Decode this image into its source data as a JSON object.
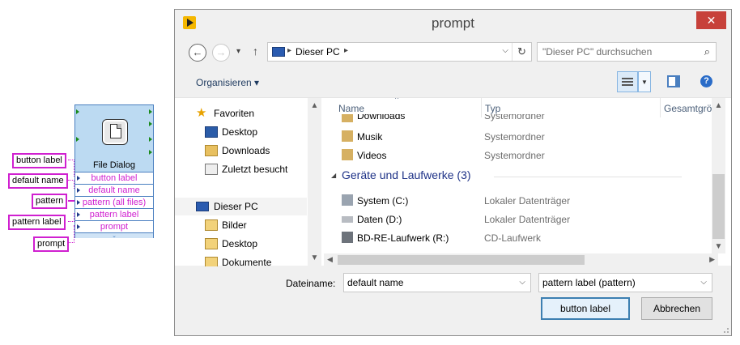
{
  "diagram": {
    "labels": {
      "button_label": "button label",
      "default_name": "default name",
      "pattern": "pattern",
      "pattern_label": "pattern label",
      "prompt": "prompt"
    },
    "node": {
      "title": "File Dialog",
      "terminals": [
        "button label",
        "default name",
        "pattern (all files)",
        "pattern label",
        "prompt"
      ]
    }
  },
  "dialog": {
    "title": "prompt",
    "close_glyph": "✕",
    "nav": {
      "back": "←",
      "forward": "→",
      "history": "▾",
      "up": "↑",
      "path": "Dieser PC",
      "path_sep": "▸",
      "dropdown": "⌵",
      "refresh": "↻",
      "search_placeholder": "\"Dieser PC\" durchsuchen",
      "search_glyph": "⌕"
    },
    "toolbar": {
      "organize": "Organisieren ▾",
      "view_dropdown": "▼",
      "help": "?"
    },
    "nav_pane": {
      "items": [
        {
          "label": "Favoriten",
          "icon": "star-icon"
        },
        {
          "label": "Desktop",
          "icon": "desktop-icon"
        },
        {
          "label": "Downloads",
          "icon": "downloads-icon"
        },
        {
          "label": "Zuletzt besucht",
          "icon": "recent-icon"
        },
        {
          "label": "Dieser PC",
          "icon": "computer-icon"
        },
        {
          "label": "Bilder",
          "icon": "pictures-icon"
        },
        {
          "label": "Desktop",
          "icon": "desktop-icon"
        },
        {
          "label": "Dokumente",
          "icon": "documents-icon"
        }
      ]
    },
    "columns": [
      "Name",
      "Typ",
      "Gesamtgröße"
    ],
    "rows": [
      {
        "name": "Downloads",
        "type": "Systemordner",
        "icon": "downloads-folder-icon"
      },
      {
        "name": "Musik",
        "type": "Systemordner",
        "icon": "music-folder-icon"
      },
      {
        "name": "Videos",
        "type": "Systemordner",
        "icon": "videos-folder-icon"
      }
    ],
    "group": {
      "title": "Geräte und Laufwerke (3)",
      "toggle": "◢"
    },
    "devices": [
      {
        "name": "System (C:)",
        "type": "Lokaler Datenträger",
        "icon": "system-drive-icon"
      },
      {
        "name": "Daten (D:)",
        "type": "Lokaler Datenträger",
        "icon": "hard-drive-icon"
      },
      {
        "name": "BD-RE-Laufwerk (R:)",
        "type": "CD-Laufwerk",
        "icon": "optical-drive-icon"
      }
    ],
    "filename_label": "Dateiname:",
    "filename_value": "default name",
    "filter_value": "pattern label (pattern)",
    "ok_button": "button label",
    "cancel_button": "Abbrechen",
    "scroll": {
      "up": "▲",
      "down": "▼",
      "left": "◀",
      "right": "▶"
    }
  }
}
